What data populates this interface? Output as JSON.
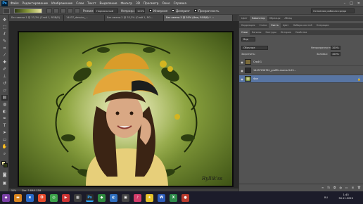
{
  "app": {
    "logo": "Ps",
    "menu": [
      "Файл",
      "Редактирование",
      "Изображение",
      "Слои",
      "Текст",
      "Выделение",
      "Фильтр",
      "3D",
      "Просмотр",
      "Окно",
      "Справка"
    ]
  },
  "options": {
    "mode_label": "Режим:",
    "mode_value": "Нормальный",
    "opacity_label": "Непрозр.:",
    "opacity_value": "100%",
    "invert_label": "Инверсия",
    "dither_label": "Дизеринг",
    "transparency_label": "Прозрачность",
    "workspace": "Основная рабочая среда"
  },
  "tabs": [
    {
      "label": "Без имени-1 @ 33,3% (Слой 1, RGB/8)"
    },
    {
      "label": "14437_dessins_..."
    },
    {
      "label": "Без имени-2 @ 33,3% (Слой 1, RG..."
    },
    {
      "label": "Без имени-3 @ 50% (Фон, RGB/8) *",
      "active": true
    }
  ],
  "canvas": {
    "signature": "Ryllik'ss"
  },
  "status": {
    "zoom": "50%",
    "doc": "Док: 3,6M/4,53M"
  },
  "right_panel": {
    "top_tabs": [
      "Цвет",
      "Навигатор",
      "Образцы",
      "Абзац"
    ],
    "mid_tabs": [
      "Коррекция",
      "Стили",
      "Кисть",
      "Цвет",
      "Наборы кистей",
      "Операции"
    ],
    "layer_tabs": [
      "Слои",
      "Каналы",
      "Контуры",
      "История",
      "Свойства"
    ],
    "filter_label": "Вид",
    "blend_mode": "Обычные",
    "opacity_label": "Непрозрачность:",
    "opacity_value": "100%",
    "lock_label": "Закрепить:",
    "fill_label": "Заливка:",
    "fill_value": "100%",
    "layers": [
      {
        "name": "Слой 1",
        "selected": false,
        "thumb": "#7a6a3a"
      },
      {
        "name": "14437256761_graffiti-mama-3-03...",
        "selected": false,
        "thumb": "#2a2a2a"
      },
      {
        "name": "Фон",
        "selected": true,
        "thumb": "#6e8a2a"
      }
    ]
  },
  "taskbar": {
    "time": "1:45",
    "date": "30.11.2020",
    "lang": "RU"
  },
  "colors": {
    "accent": "#5875a3",
    "canvas_bg": "#6f8a33"
  }
}
